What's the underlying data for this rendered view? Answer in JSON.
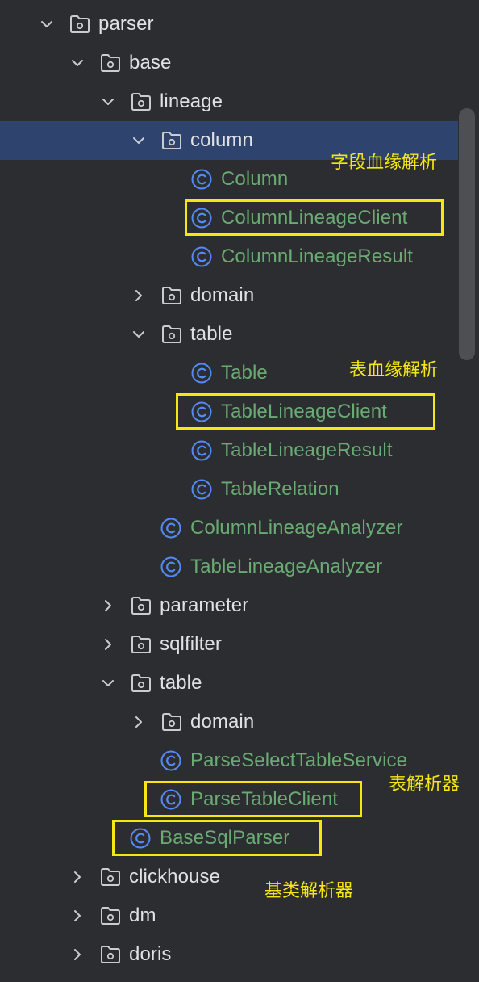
{
  "colors": {
    "background": "#2b2d30",
    "selection": "#2e436e",
    "folder_text": "#dfe1e5",
    "class_text": "#6aab73",
    "class_icon": "#548af7",
    "highlight": "#f5e614"
  },
  "tree": [
    {
      "label": "parser",
      "type": "folder",
      "state": "expanded"
    },
    {
      "label": "base",
      "type": "folder",
      "state": "expanded"
    },
    {
      "label": "lineage",
      "type": "folder",
      "state": "expanded"
    },
    {
      "label": "column",
      "type": "folder",
      "state": "expanded",
      "selected": true
    },
    {
      "label": "Column",
      "type": "class"
    },
    {
      "label": "ColumnLineageClient",
      "type": "class",
      "highlighted": true
    },
    {
      "label": "ColumnLineageResult",
      "type": "class"
    },
    {
      "label": "domain",
      "type": "folder",
      "state": "collapsed"
    },
    {
      "label": "table",
      "type": "folder",
      "state": "expanded"
    },
    {
      "label": "Table",
      "type": "class"
    },
    {
      "label": "TableLineageClient",
      "type": "class",
      "highlighted": true
    },
    {
      "label": "TableLineageResult",
      "type": "class"
    },
    {
      "label": "TableRelation",
      "type": "class"
    },
    {
      "label": "ColumnLineageAnalyzer",
      "type": "class"
    },
    {
      "label": "TableLineageAnalyzer",
      "type": "class"
    },
    {
      "label": "parameter",
      "type": "folder",
      "state": "collapsed"
    },
    {
      "label": "sqlfilter",
      "type": "folder",
      "state": "collapsed"
    },
    {
      "label": "table",
      "type": "folder",
      "state": "expanded"
    },
    {
      "label": "domain",
      "type": "folder",
      "state": "collapsed"
    },
    {
      "label": "ParseSelectTableService",
      "type": "class"
    },
    {
      "label": "ParseTableClient",
      "type": "class",
      "highlighted": true
    },
    {
      "label": "BaseSqlParser",
      "type": "class",
      "highlighted": true
    },
    {
      "label": "clickhouse",
      "type": "folder",
      "state": "collapsed"
    },
    {
      "label": "dm",
      "type": "folder",
      "state": "collapsed"
    },
    {
      "label": "doris",
      "type": "folder",
      "state": "collapsed"
    }
  ],
  "annotations": [
    {
      "text": "字段血缘解析"
    },
    {
      "text": "表血缘解析"
    },
    {
      "text": "表解析器"
    },
    {
      "text": "基类解析器"
    }
  ]
}
